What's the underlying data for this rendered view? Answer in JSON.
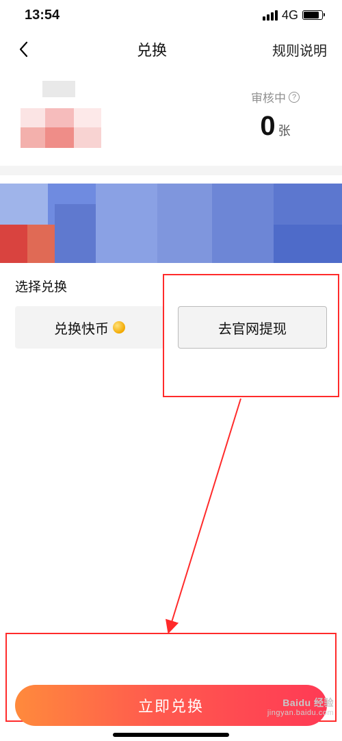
{
  "status": {
    "time": "13:54",
    "network": "4G"
  },
  "nav": {
    "title": "兑换",
    "right": "规则说明"
  },
  "info": {
    "audit_label": "审核中",
    "count_value": "0",
    "count_unit": "张"
  },
  "select": {
    "label": "选择兑换",
    "option_coin": "兑换快币",
    "option_withdraw": "去官网提现"
  },
  "cta": {
    "label": "立即兑换"
  },
  "watermark": {
    "brand": "Baidu 经验",
    "url": "jingyan.baidu.com"
  }
}
